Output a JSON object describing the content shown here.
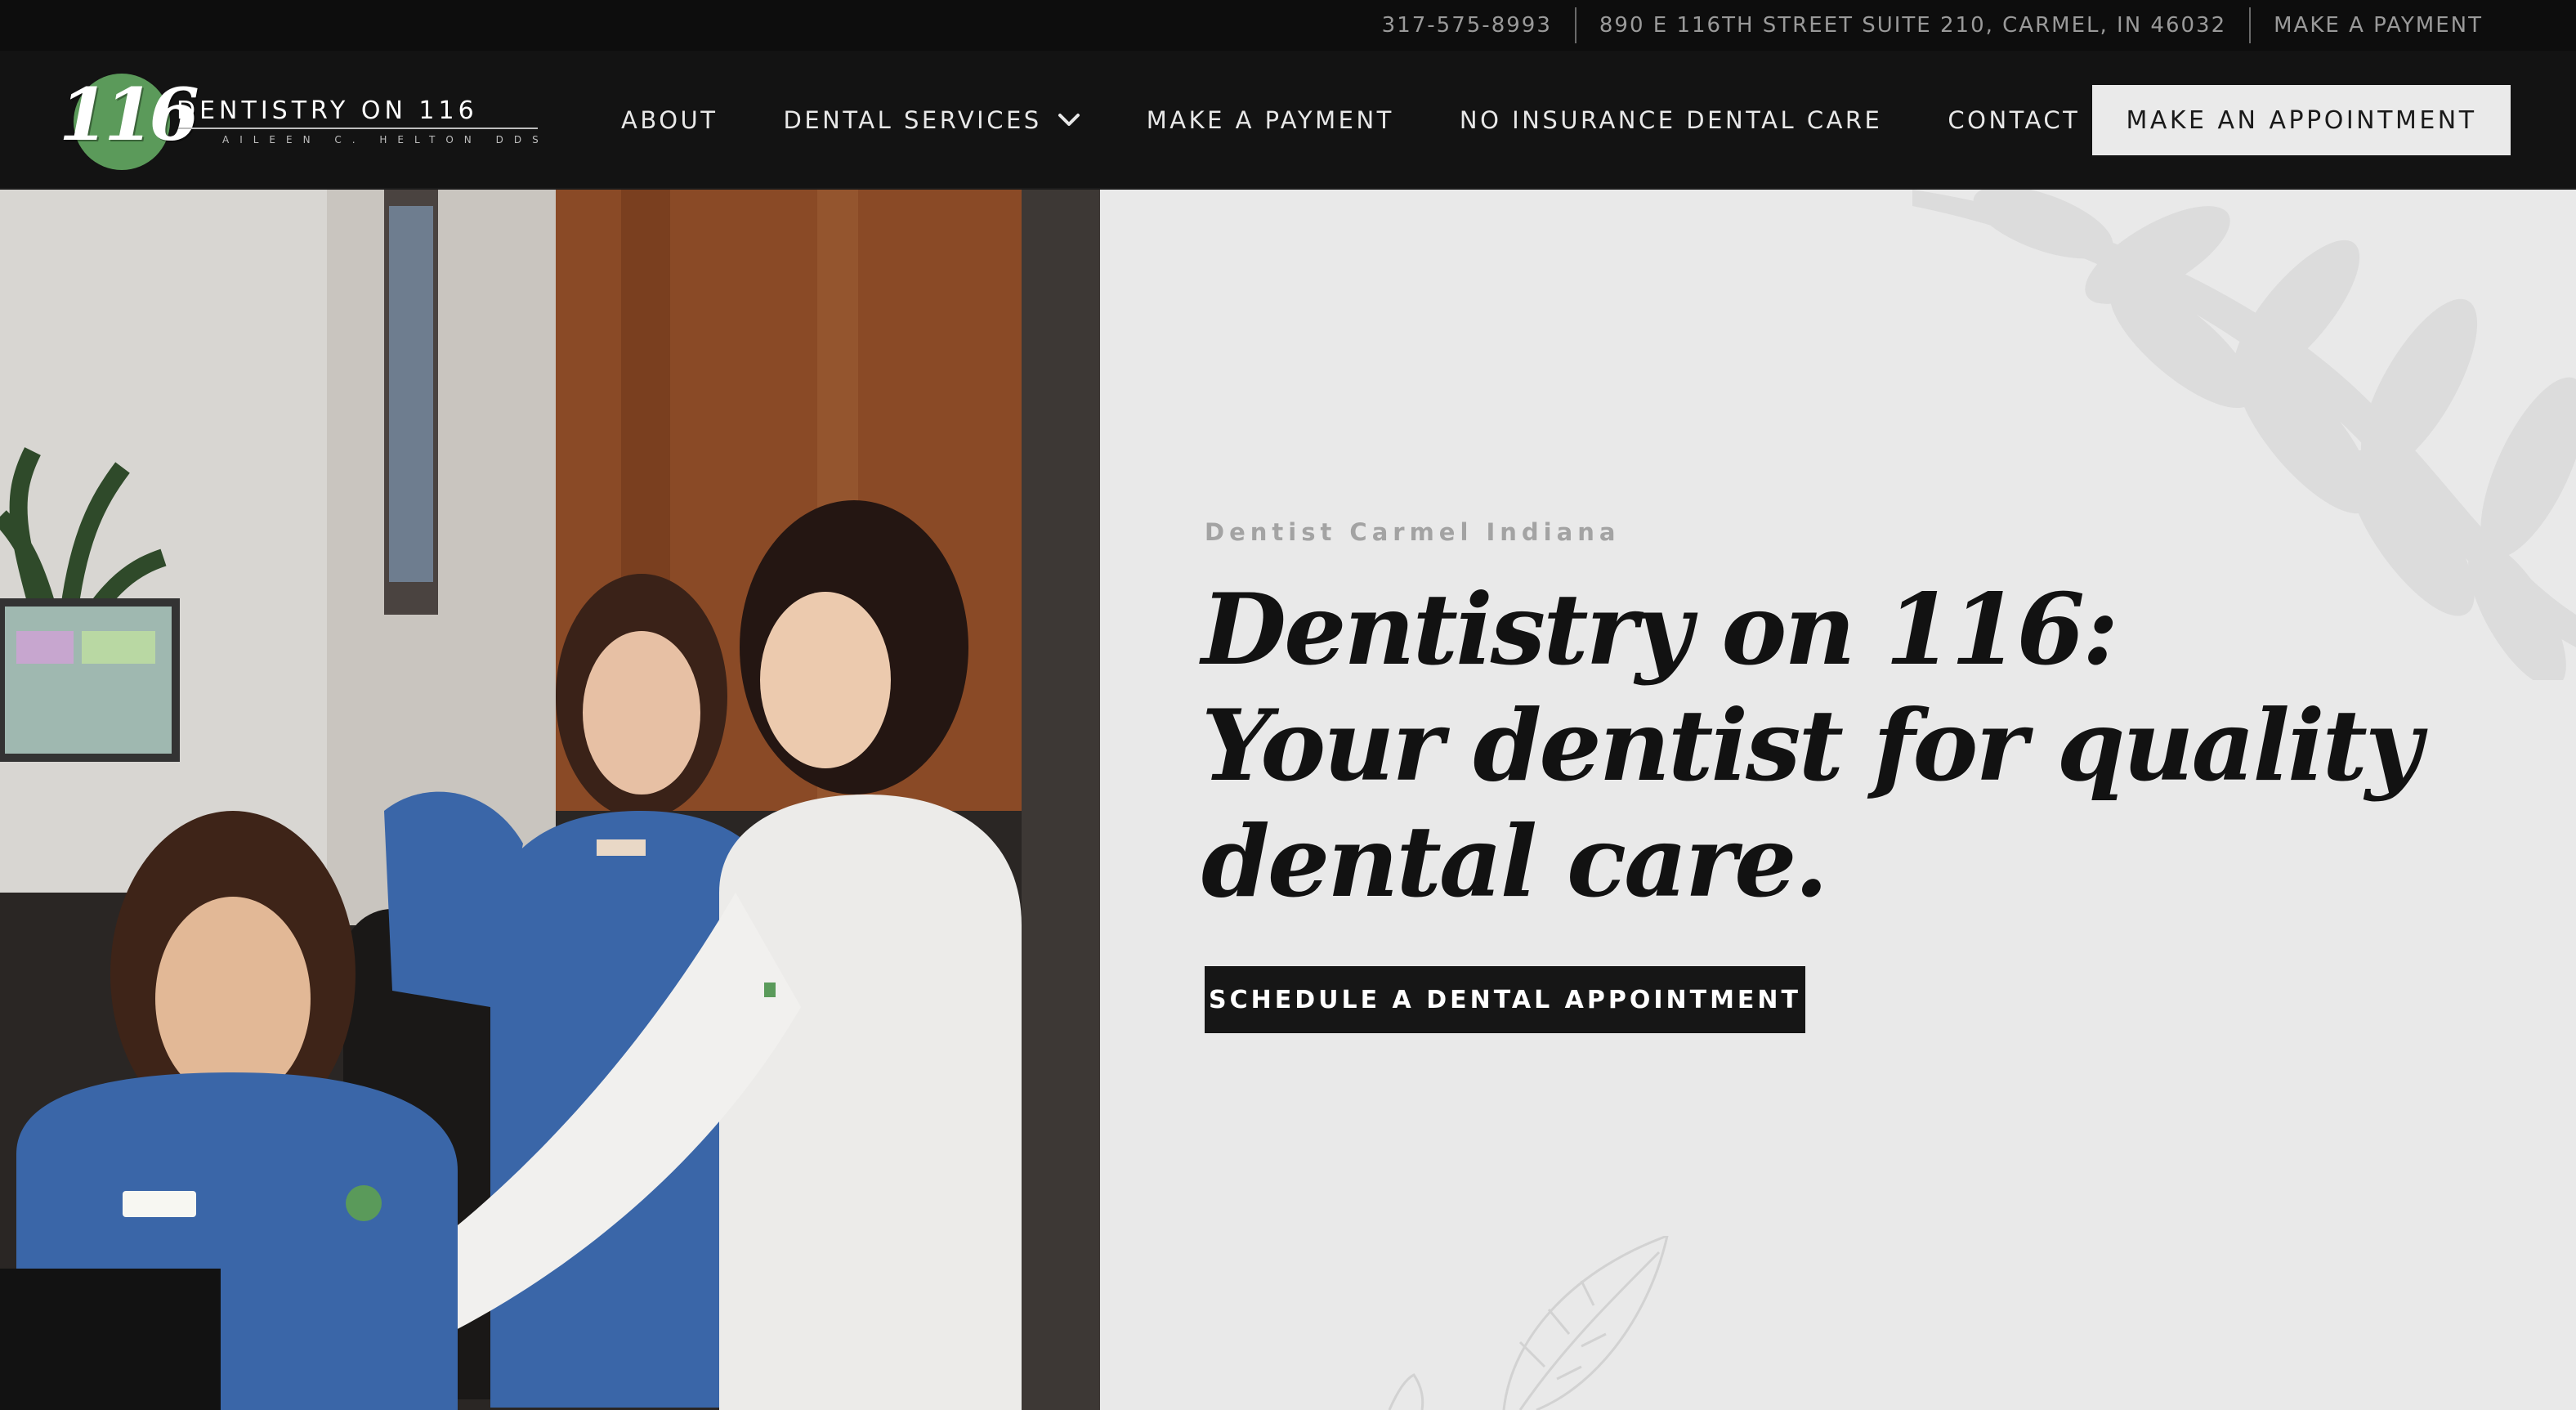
{
  "topbar": {
    "phone": "317-575-8993",
    "address": "890 E 116TH STREET SUITE 210, CARMEL, IN 46032",
    "payment": "MAKE A PAYMENT"
  },
  "logo": {
    "number": "116",
    "name": "DENTISTRY ON 116",
    "subtitle": "AILEEN C. HELTON DDS"
  },
  "nav": {
    "items": [
      {
        "label": "ABOUT"
      },
      {
        "label": "DENTAL SERVICES",
        "has_dropdown": true
      },
      {
        "label": "MAKE A PAYMENT"
      },
      {
        "label": "NO INSURANCE DENTAL CARE"
      },
      {
        "label": "CONTACT"
      }
    ],
    "appointment_button": "MAKE AN APPOINTMENT"
  },
  "hero": {
    "eyebrow": "Dentist Carmel Indiana",
    "headline": {
      "line1": "Dentistry on 116:",
      "line2": "Your dentist for quality",
      "line3": "dental care."
    },
    "cta": "SCHEDULE A DENTAL APPOINTMENT"
  },
  "colors": {
    "topbar_bg": "#0d0d0d",
    "nav_bg": "#131313",
    "hero_bg": "#e9e9e9",
    "brand_green": "#5b9a5a",
    "text_dark": "#121212",
    "eyebrow_gray": "#a3a3a3"
  },
  "icons": {
    "dropdown": "chevron-down-icon",
    "decor": "leaf-branch-icon"
  }
}
